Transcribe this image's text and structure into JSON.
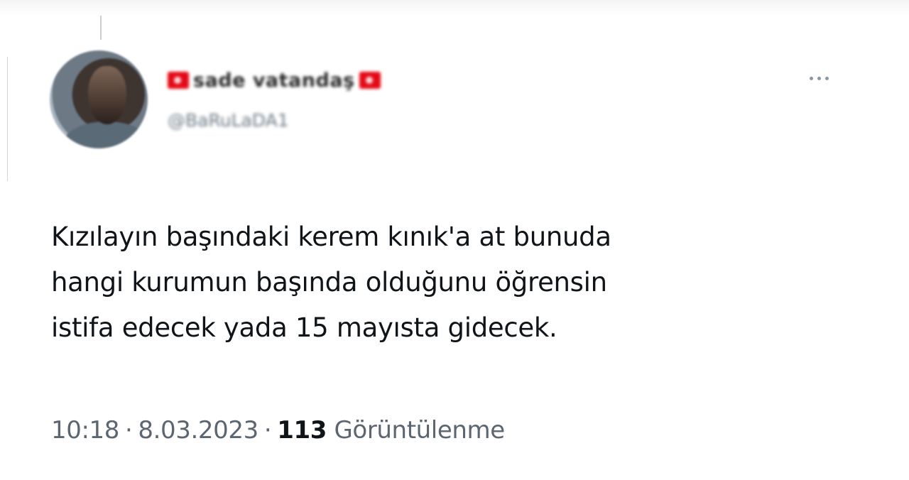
{
  "tweet": {
    "author": {
      "display_name": "sade vatandaş",
      "handle": "@BaRuLaDA1",
      "flag_color": "#e30a17",
      "avatar_icon": "user-photo"
    },
    "more_icon": "more-horizontal-icon",
    "text_lines": [
      "Kızılayın başındaki kerem kınık'a at bunuda",
      "hangi kurumun başında olduğunu öğrensin",
      "istifa edecek yada 15 mayısta gidecek."
    ],
    "time": "10:18",
    "date": "8.03.2023",
    "separator": "·",
    "views_count": "113",
    "views_label": "Görüntülenme"
  }
}
